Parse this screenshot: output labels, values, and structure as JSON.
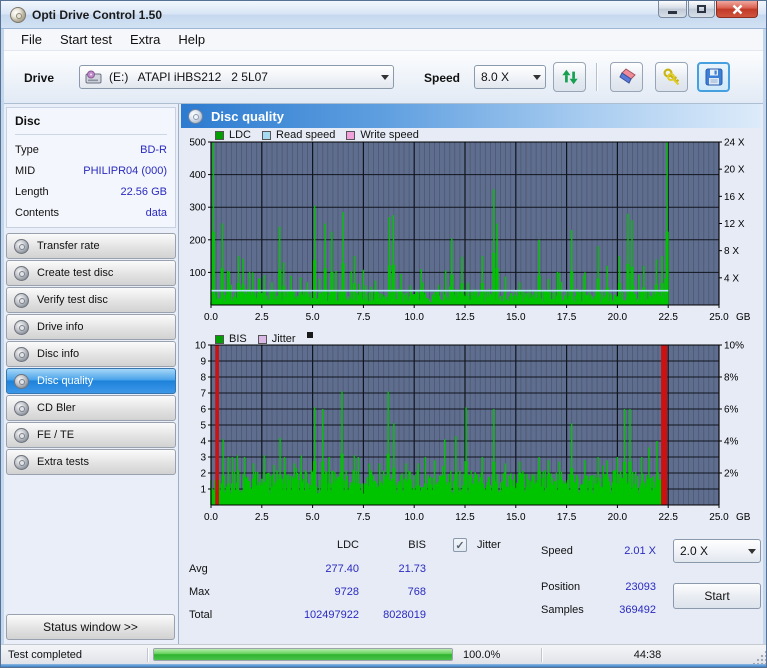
{
  "window": {
    "title": "Opti Drive Control 1.50"
  },
  "menu": {
    "items": [
      "File",
      "Start test",
      "Extra",
      "Help"
    ]
  },
  "toolbar": {
    "drive_label": "Drive",
    "drive_value": "(E:)   ATAPI iHBS212   2 5L07",
    "speed_label": "Speed",
    "speed_value": "8.0 X"
  },
  "sidebar": {
    "disc_header": "Disc",
    "info": [
      {
        "label": "Type",
        "value": "BD-R"
      },
      {
        "label": "MID",
        "value": "PHILIPR04 (000)"
      },
      {
        "label": "Length",
        "value": "22.56 GB"
      },
      {
        "label": "Contents",
        "value": "data"
      }
    ],
    "buttons": [
      {
        "label": "Transfer rate"
      },
      {
        "label": "Create test disc"
      },
      {
        "label": "Verify test disc"
      },
      {
        "label": "Drive info"
      },
      {
        "label": "Disc info"
      },
      {
        "label": "Disc quality"
      },
      {
        "label": "CD Bler"
      },
      {
        "label": "FE / TE"
      },
      {
        "label": "Extra tests"
      }
    ],
    "active_index": 5,
    "status_window_button": "Status window >>"
  },
  "content": {
    "header": "Disc quality"
  },
  "stats": {
    "col_headers": [
      "LDC",
      "BIS"
    ],
    "rows": [
      {
        "label": "Avg",
        "ldc": "277.40",
        "bis": "21.73"
      },
      {
        "label": "Max",
        "ldc": "9728",
        "bis": "768"
      },
      {
        "label": "Total",
        "ldc": "102497922",
        "bis": "8028019"
      }
    ],
    "jitter_label": "Jitter",
    "jitter_checked": "✓",
    "speed_label": "Speed",
    "speed_value": "2.01 X",
    "speed_select": "2.0 X",
    "position_label": "Position",
    "position_value": "23093",
    "samples_label": "Samples",
    "samples_value": "369492",
    "start_button": "Start"
  },
  "statusbar": {
    "text": "Test completed",
    "percent": "100.0%",
    "time": "44:38",
    "progress_value": 100
  },
  "chart_data": [
    {
      "type": "bar",
      "title": "LDC errors vs position",
      "legend": [
        {
          "label": "LDC",
          "color": "#00a000"
        },
        {
          "label": "Read speed",
          "color": "#a6d9f2"
        },
        {
          "label": "Write speed",
          "color": "#f2a0dc"
        }
      ],
      "xlim": [
        0,
        25
      ],
      "x_ticks": [
        0,
        2.5,
        5,
        7.5,
        10,
        12.5,
        15,
        17.5,
        20,
        22.5,
        25
      ],
      "x_unit": "GB",
      "ylim": [
        0,
        500
      ],
      "y_ticks": [
        100,
        200,
        300,
        400,
        500
      ],
      "y2": {
        "max": 24,
        "ticks": [
          4,
          8,
          12,
          16,
          20,
          24
        ],
        "suffix": " X"
      },
      "bar_color": "#00c400",
      "data_end_x": 22.5,
      "baseline": {
        "seed": 7,
        "min": 8,
        "max": 50,
        "step": 0.05,
        "boost_prob": 0.06,
        "boost_mult": 2.4
      },
      "spikes": [
        [
          0.12,
          500
        ],
        [
          0.55,
          250
        ],
        [
          0.82,
          105
        ],
        [
          1.35,
          150
        ],
        [
          1.58,
          142
        ],
        [
          2.05,
          100
        ],
        [
          2.35,
          80
        ],
        [
          2.62,
          92
        ],
        [
          3.0,
          70
        ],
        [
          3.38,
          240
        ],
        [
          3.58,
          130
        ],
        [
          3.95,
          90
        ],
        [
          4.4,
          85
        ],
        [
          4.75,
          70
        ],
        [
          5.1,
          305
        ],
        [
          5.35,
          80
        ],
        [
          5.62,
          250
        ],
        [
          5.95,
          225
        ],
        [
          6.5,
          285
        ],
        [
          7.05,
          150
        ],
        [
          7.3,
          65
        ],
        [
          7.62,
          60
        ],
        [
          8.1,
          75
        ],
        [
          8.78,
          270
        ],
        [
          8.98,
          275
        ],
        [
          9.35,
          95
        ],
        [
          9.8,
          60
        ],
        [
          10.45,
          70
        ],
        [
          11.2,
          62
        ],
        [
          11.85,
          205
        ],
        [
          12.35,
          148
        ],
        [
          12.65,
          60
        ],
        [
          13.35,
          150
        ],
        [
          13.92,
          355
        ],
        [
          14.08,
          250
        ],
        [
          15.2,
          70
        ],
        [
          16.15,
          200
        ],
        [
          16.6,
          80
        ],
        [
          17.75,
          230
        ],
        [
          18.35,
          90
        ],
        [
          19.05,
          180
        ],
        [
          19.5,
          120
        ],
        [
          20.1,
          150
        ],
        [
          20.52,
          280
        ],
        [
          20.72,
          260
        ],
        [
          21.3,
          120
        ],
        [
          21.92,
          140
        ],
        [
          22.2,
          150
        ],
        [
          22.45,
          500
        ]
      ],
      "line": {
        "value": 2.1,
        "axis": "y2",
        "color": "#b8e4f5"
      }
    },
    {
      "type": "bar",
      "title": "BIS errors vs position",
      "legend": [
        {
          "label": "BIS",
          "color": "#00a000"
        },
        {
          "label": "Jitter",
          "color": "#d9b8e6"
        }
      ],
      "legend_marker": true,
      "xlim": [
        0,
        25
      ],
      "x_ticks": [
        0,
        2.5,
        5,
        7.5,
        10,
        12.5,
        15,
        17.5,
        20,
        22.5,
        25
      ],
      "x_unit": "GB",
      "ylim": [
        0,
        10
      ],
      "y_ticks": [
        1,
        2,
        3,
        4,
        5,
        6,
        7,
        8,
        9,
        10
      ],
      "y2": {
        "max": 10,
        "ticks": [
          2,
          4,
          6,
          8,
          10
        ],
        "suffix": "%"
      },
      "bar_color": "#00c400",
      "data_end_x": 22.25,
      "baseline": {
        "seed": 13,
        "min": 0.7,
        "max": 2.2,
        "step": 0.05,
        "boost_prob": 0.05,
        "boost_mult": 1.3
      },
      "spikes": [
        [
          0.6,
          4.1
        ],
        [
          0.85,
          3.0
        ],
        [
          1.05,
          3.0
        ],
        [
          1.3,
          3.1
        ],
        [
          1.65,
          3.0
        ],
        [
          2.1,
          2.6
        ],
        [
          2.62,
          3.1
        ],
        [
          3.1,
          2.5
        ],
        [
          3.4,
          4.2
        ],
        [
          3.62,
          3.0
        ],
        [
          4.1,
          2.6
        ],
        [
          4.45,
          3.1
        ],
        [
          5.1,
          6.1
        ],
        [
          5.5,
          6.0
        ],
        [
          5.82,
          3.0
        ],
        [
          6.45,
          7.1
        ],
        [
          7.05,
          3.1
        ],
        [
          7.25,
          3.0
        ],
        [
          7.8,
          2.6
        ],
        [
          8.3,
          2.6
        ],
        [
          8.72,
          7.1
        ],
        [
          9.0,
          5.1
        ],
        [
          9.6,
          2.6
        ],
        [
          10.2,
          2.6
        ],
        [
          10.55,
          3.0
        ],
        [
          11.0,
          2.8
        ],
        [
          11.5,
          4.1
        ],
        [
          12.05,
          4.3
        ],
        [
          12.55,
          6.1
        ],
        [
          13.35,
          3.0
        ],
        [
          13.92,
          6.0
        ],
        [
          14.5,
          2.6
        ],
        [
          15.2,
          2.7
        ],
        [
          16.15,
          3.0
        ],
        [
          16.6,
          2.8
        ],
        [
          17.15,
          2.7
        ],
        [
          17.75,
          5.1
        ],
        [
          18.4,
          2.8
        ],
        [
          19.05,
          3.0
        ],
        [
          19.5,
          2.8
        ],
        [
          20.0,
          3.0
        ],
        [
          20.35,
          6.0
        ],
        [
          20.62,
          6.0
        ],
        [
          21.2,
          3.0
        ],
        [
          21.55,
          3.6
        ],
        [
          21.95,
          4.0
        ]
      ],
      "red_bars": {
        "color": "#cc1111",
        "bars": [
          [
            0.3,
            0.18
          ],
          [
            22.3,
            0.3
          ]
        ]
      }
    }
  ]
}
